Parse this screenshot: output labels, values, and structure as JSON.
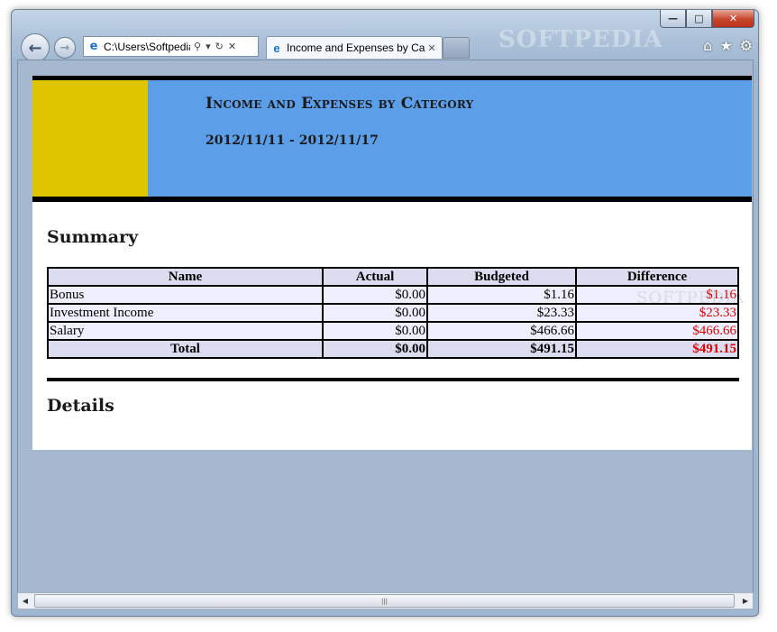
{
  "browser": {
    "address_text": "C:\\Users\\Softpedia\\",
    "tab_title": "Income and Expenses by Ca...",
    "watermark": "SOFTPEDIA",
    "icons": [
      "back-arrow-icon",
      "forward-arrow-icon",
      "ie-icon",
      "search-icon",
      "dropdown-icon",
      "refresh-icon",
      "stop-icon",
      "home-icon",
      "favorites-star-icon",
      "gear-icon"
    ]
  },
  "report": {
    "title": "Income and Expenses by Category",
    "date_range": "2012/11/11 - 2012/11/17",
    "summary_heading": "Summary",
    "details_heading": "Details",
    "columns": [
      "Name",
      "Actual",
      "Budgeted",
      "Difference"
    ],
    "rows": [
      {
        "name": "Bonus",
        "actual": "$0.00",
        "budgeted": "$1.16",
        "difference": "$1.16"
      },
      {
        "name": "Investment Income",
        "actual": "$0.00",
        "budgeted": "$23.33",
        "difference": "$23.33"
      },
      {
        "name": "Salary",
        "actual": "$0.00",
        "budgeted": "$466.66",
        "difference": "$466.66"
      }
    ],
    "total": {
      "name": "Total",
      "actual": "$0.00",
      "budgeted": "$491.15",
      "difference": "$491.15"
    },
    "watermark": "SOFTPEDIA"
  },
  "colors": {
    "header_blue": "#5c9fe8",
    "header_yellow": "#dfc500",
    "negative_red": "#e00000",
    "table_header": "#dcdcf0",
    "table_row": "#eeeefc"
  }
}
